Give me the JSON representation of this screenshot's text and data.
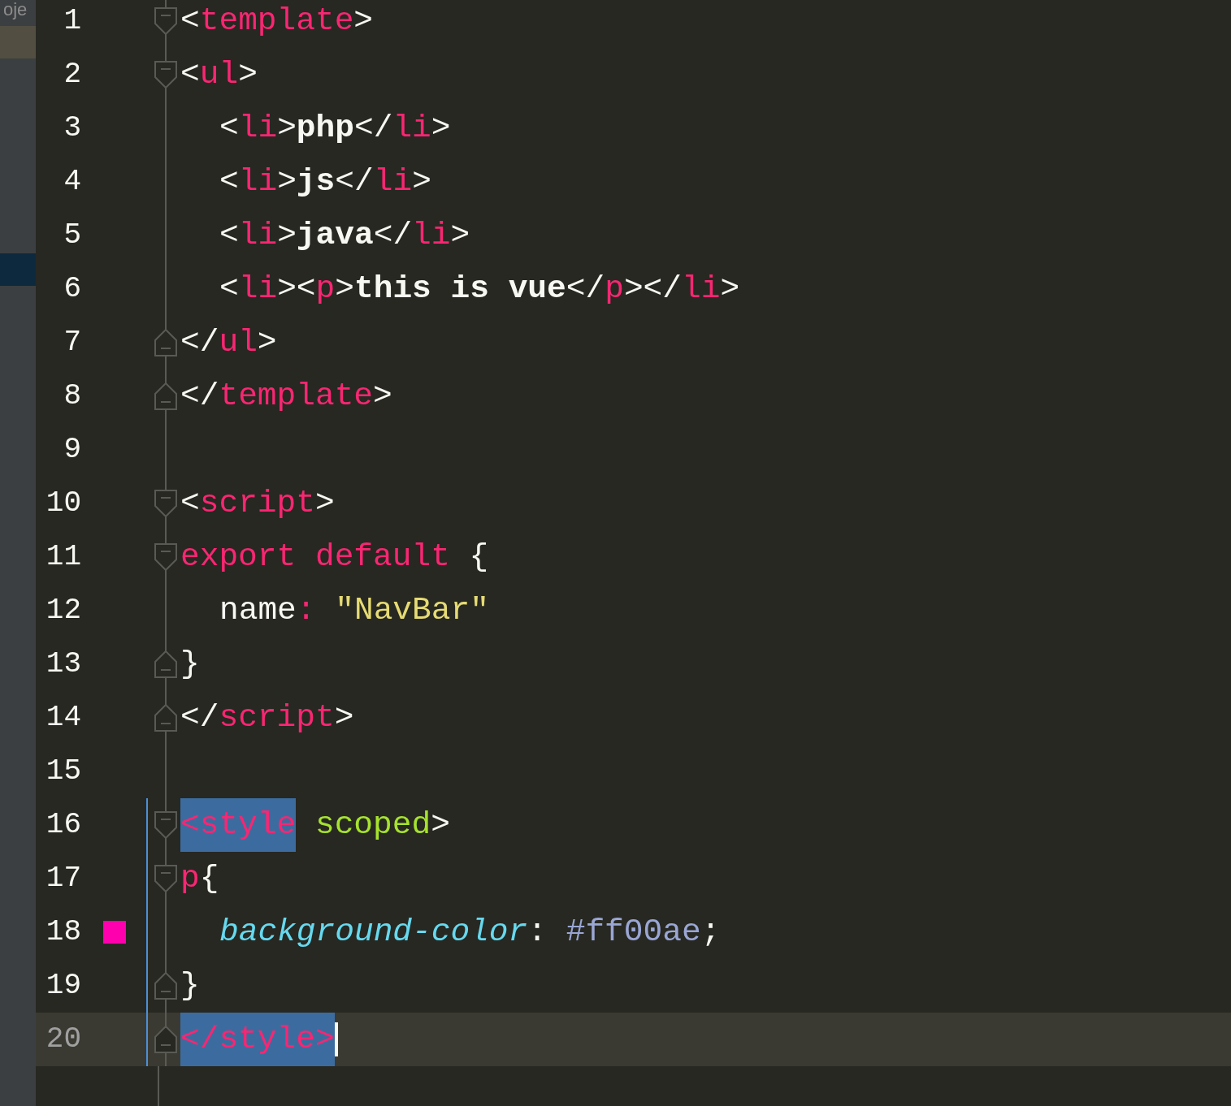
{
  "sidebar": {
    "label": "oje",
    "rows": [
      {
        "kind": "hovered"
      },
      {
        "kind": "plain"
      },
      {
        "kind": "plain"
      },
      {
        "kind": "plain"
      },
      {
        "kind": "plain"
      },
      {
        "kind": "plain"
      },
      {
        "kind": "plain"
      },
      {
        "kind": "selected"
      }
    ]
  },
  "editor": {
    "lines": [
      {
        "number": "1",
        "fold_start": true,
        "fold_end": false,
        "indented": false,
        "changed": false,
        "current": false,
        "tokens": [
          {
            "text": "<",
            "kind": "punct"
          },
          {
            "text": "template",
            "kind": "tag"
          },
          {
            "text": ">",
            "kind": "punct"
          }
        ]
      },
      {
        "number": "2",
        "fold_start": true,
        "fold_end": false,
        "indented": false,
        "changed": false,
        "current": false,
        "tokens": [
          {
            "text": "<",
            "kind": "punct"
          },
          {
            "text": "ul",
            "kind": "tag"
          },
          {
            "text": ">",
            "kind": "punct"
          }
        ]
      },
      {
        "number": "3",
        "fold_start": false,
        "fold_end": false,
        "indented": true,
        "changed": false,
        "current": false,
        "tokens": [
          {
            "text": "<",
            "kind": "punct"
          },
          {
            "text": "li",
            "kind": "tag"
          },
          {
            "text": ">",
            "kind": "punct"
          },
          {
            "text": "php",
            "kind": "content"
          },
          {
            "text": "</",
            "kind": "punct"
          },
          {
            "text": "li",
            "kind": "tag"
          },
          {
            "text": ">",
            "kind": "punct"
          }
        ]
      },
      {
        "number": "4",
        "fold_start": false,
        "fold_end": false,
        "indented": true,
        "changed": false,
        "current": false,
        "tokens": [
          {
            "text": "<",
            "kind": "punct"
          },
          {
            "text": "li",
            "kind": "tag"
          },
          {
            "text": ">",
            "kind": "punct"
          },
          {
            "text": "js",
            "kind": "content"
          },
          {
            "text": "</",
            "kind": "punct"
          },
          {
            "text": "li",
            "kind": "tag"
          },
          {
            "text": ">",
            "kind": "punct"
          }
        ]
      },
      {
        "number": "5",
        "fold_start": false,
        "fold_end": false,
        "indented": true,
        "changed": false,
        "current": false,
        "tokens": [
          {
            "text": "<",
            "kind": "punct"
          },
          {
            "text": "li",
            "kind": "tag"
          },
          {
            "text": ">",
            "kind": "punct"
          },
          {
            "text": "java",
            "kind": "content"
          },
          {
            "text": "</",
            "kind": "punct"
          },
          {
            "text": "li",
            "kind": "tag"
          },
          {
            "text": ">",
            "kind": "punct"
          }
        ]
      },
      {
        "number": "6",
        "fold_start": false,
        "fold_end": false,
        "indented": true,
        "changed": false,
        "current": false,
        "tokens": [
          {
            "text": "<",
            "kind": "punct"
          },
          {
            "text": "li",
            "kind": "tag"
          },
          {
            "text": "><",
            "kind": "punct"
          },
          {
            "text": "p",
            "kind": "tag"
          },
          {
            "text": ">",
            "kind": "punct"
          },
          {
            "text": "this is vue",
            "kind": "content"
          },
          {
            "text": "</",
            "kind": "punct"
          },
          {
            "text": "p",
            "kind": "tag"
          },
          {
            "text": "></",
            "kind": "punct"
          },
          {
            "text": "li",
            "kind": "tag"
          },
          {
            "text": ">",
            "kind": "punct"
          }
        ]
      },
      {
        "number": "7",
        "fold_start": false,
        "fold_end": true,
        "indented": false,
        "changed": false,
        "current": false,
        "tokens": [
          {
            "text": "</",
            "kind": "punct"
          },
          {
            "text": "ul",
            "kind": "tag"
          },
          {
            "text": ">",
            "kind": "punct"
          }
        ]
      },
      {
        "number": "8",
        "fold_start": false,
        "fold_end": true,
        "indented": false,
        "changed": false,
        "current": false,
        "tokens": [
          {
            "text": "</",
            "kind": "punct"
          },
          {
            "text": "template",
            "kind": "tag"
          },
          {
            "text": ">",
            "kind": "punct"
          }
        ]
      },
      {
        "number": "9",
        "fold_start": false,
        "fold_end": false,
        "indented": false,
        "changed": false,
        "current": false
      },
      {
        "number": "10",
        "fold_start": true,
        "fold_end": false,
        "indented": false,
        "changed": false,
        "current": false,
        "tokens": [
          {
            "text": "<",
            "kind": "punct"
          },
          {
            "text": "script",
            "kind": "tag"
          },
          {
            "text": ">",
            "kind": "punct"
          }
        ]
      },
      {
        "number": "11",
        "fold_start": true,
        "fold_end": false,
        "indented": false,
        "changed": false,
        "current": false,
        "tokens": [
          {
            "text": "export default",
            "kind": "keyword"
          },
          {
            "text": " {",
            "kind": "punct"
          }
        ]
      },
      {
        "number": "12",
        "fold_start": false,
        "fold_end": false,
        "indented": true,
        "changed": false,
        "current": false,
        "tokens": [
          {
            "text": "name",
            "kind": "punct"
          },
          {
            "text": ":",
            "kind": "keyword"
          },
          {
            "text": " \"NavBar\"",
            "kind": "string"
          }
        ]
      },
      {
        "number": "13",
        "fold_start": false,
        "fold_end": true,
        "indented": false,
        "changed": false,
        "current": false,
        "tokens": [
          {
            "text": "}",
            "kind": "punct"
          }
        ]
      },
      {
        "number": "14",
        "fold_start": false,
        "fold_end": true,
        "indented": false,
        "changed": false,
        "current": false,
        "tokens": [
          {
            "text": "</",
            "kind": "punct"
          },
          {
            "text": "script",
            "kind": "tag"
          },
          {
            "text": ">",
            "kind": "punct"
          }
        ]
      },
      {
        "number": "15",
        "fold_start": false,
        "fold_end": false,
        "indented": false,
        "changed": false,
        "current": false
      },
      {
        "number": "16",
        "fold_start": true,
        "fold_end": false,
        "indented": false,
        "changed": true,
        "current": false,
        "tokens": [
          {
            "text": "<style",
            "kind": "tag",
            "selected": true
          },
          {
            "text": " scoped",
            "kind": "attr",
            "selected": false
          },
          {
            "text": ">",
            "kind": "punct",
            "selected": false
          }
        ]
      },
      {
        "number": "17",
        "fold_start": true,
        "fold_end": false,
        "indented": false,
        "changed": true,
        "current": false,
        "tokens": [
          {
            "text": "p",
            "kind": "tag"
          },
          {
            "text": "{",
            "kind": "punct"
          }
        ]
      },
      {
        "number": "18",
        "fold_start": false,
        "fold_end": false,
        "indented": true,
        "changed": true,
        "current": false,
        "color": "#ff00ae",
        "tokens": [
          {
            "text": "background-color",
            "kind": "property"
          },
          {
            "text": ": ",
            "kind": "punct"
          },
          {
            "text": "#ff00ae",
            "kind": "value"
          },
          {
            "text": ";",
            "kind": "punct"
          }
        ]
      },
      {
        "number": "19",
        "fold_start": false,
        "fold_end": true,
        "indented": false,
        "changed": true,
        "current": false,
        "tokens": [
          {
            "text": "}",
            "kind": "punct"
          }
        ]
      },
      {
        "number": "20",
        "fold_start": false,
        "fold_end": true,
        "indented": false,
        "changed": true,
        "current": true,
        "tokens": [
          {
            "text": "</style>",
            "kind": "tag",
            "selected": true
          }
        ]
      }
    ]
  }
}
